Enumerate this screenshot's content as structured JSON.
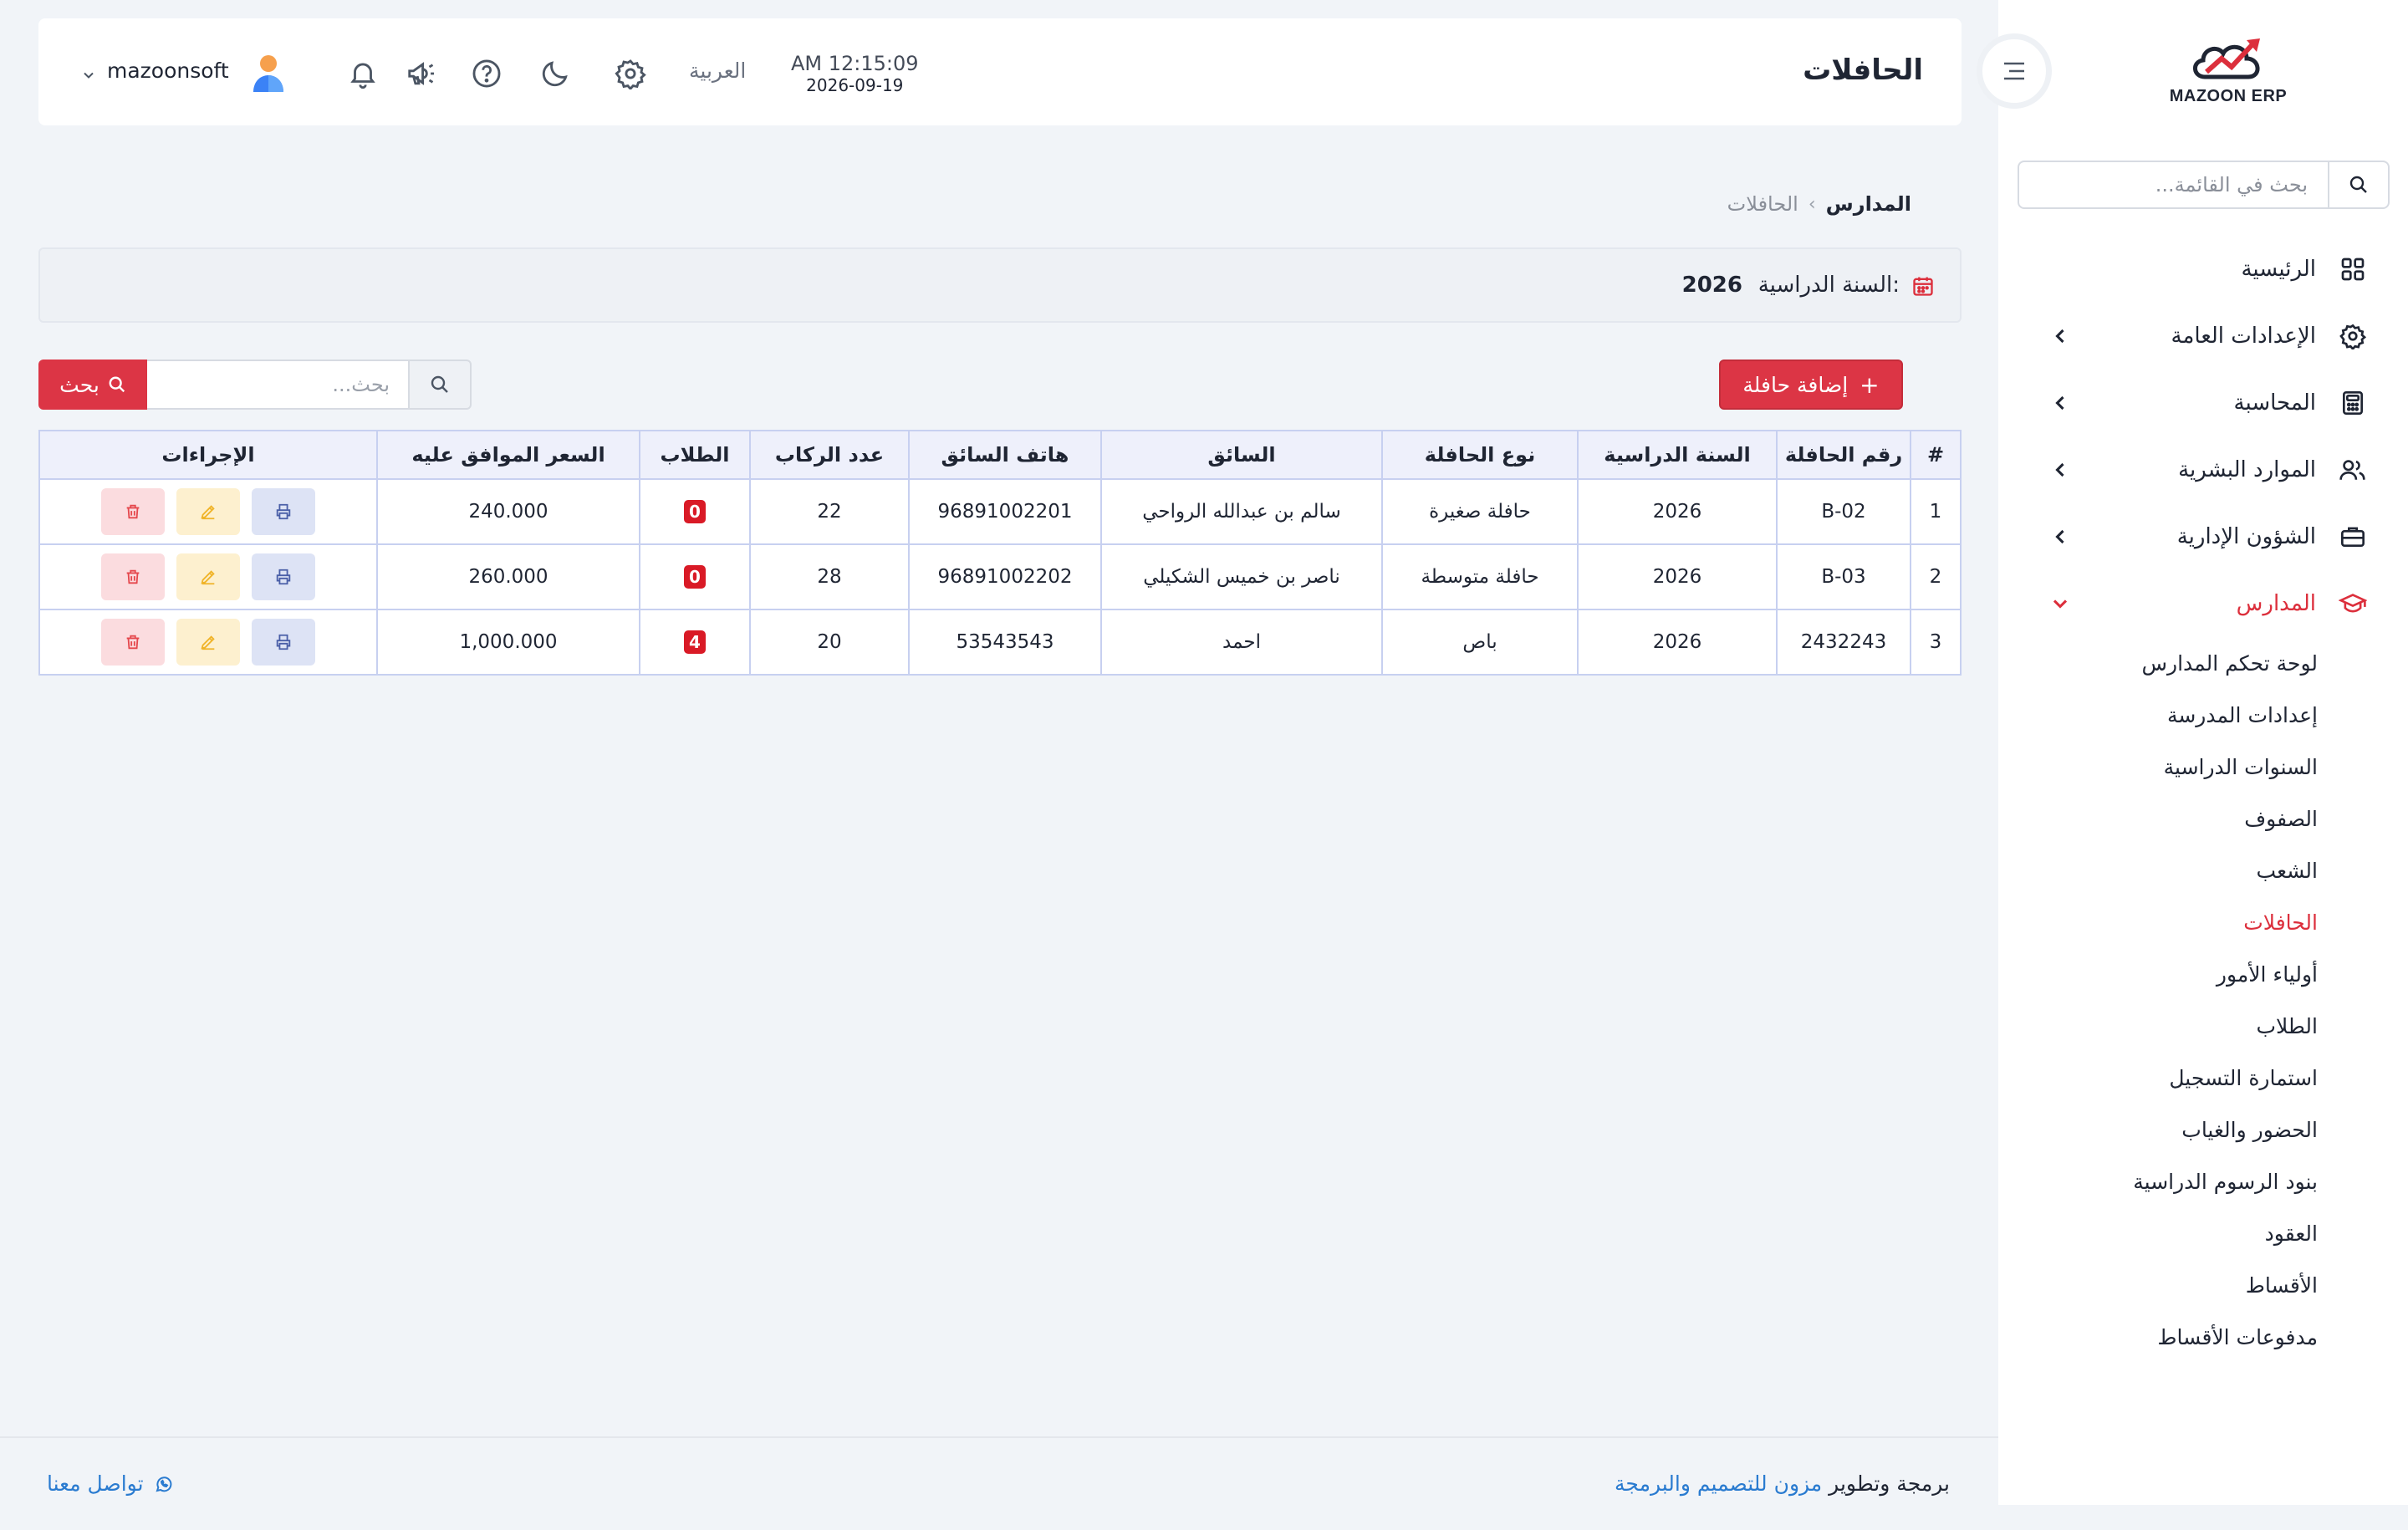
{
  "header": {
    "page_title": "الحافلات",
    "time": "AM 12:15:09",
    "date": "2026-09-19",
    "language": "العربية",
    "username": "mazoonsoft"
  },
  "sidebar": {
    "logo_text": "MAZOON ERP",
    "search_placeholder": "بحث في القائمة...",
    "items": [
      {
        "label": "الرئيسية",
        "icon": "grid-icon"
      },
      {
        "label": "الإعدادات العامة",
        "icon": "gear-icon"
      },
      {
        "label": "المحاسبة",
        "icon": "calculator-icon"
      },
      {
        "label": "الموارد البشرية",
        "icon": "users-icon"
      },
      {
        "label": "الشؤون الإدارية",
        "icon": "briefcase-icon"
      },
      {
        "label": "المدارس",
        "icon": "graduation-cap-icon"
      }
    ],
    "schools_submenu": [
      "لوحة تحكم المدارس",
      "إعدادات المدرسة",
      "السنوات الدراسية",
      "الصفوف",
      "الشعب",
      "الحافلات",
      "أولياء الأمور",
      "الطلاب",
      "استمارة التسجيل",
      "الحضور والغياب",
      "بنود الرسوم الدراسية",
      "العقود",
      "الأقساط",
      "مدفوعات الأقساط"
    ]
  },
  "breadcrumb": {
    "root": "المدارس",
    "separator": "‹",
    "current": "الحافلات"
  },
  "year_bar": {
    "label": "السنة الدراسية:",
    "value": "2026"
  },
  "toolbar": {
    "add_label": "إضافة حافلة",
    "add_icon": "+",
    "search_placeholder": "بحث...",
    "search_label": "بحث"
  },
  "table": {
    "columns": [
      "#",
      "رقم الحافلة",
      "السنة الدراسية",
      "نوع الحافلة",
      "السائق",
      "هاتف السائق",
      "عدد الركاب",
      "الطلاب",
      "السعر الموافق عليه",
      "الإجراءات"
    ],
    "rows": [
      {
        "num": "1",
        "bus_no": "B-02",
        "year": "2026",
        "type": "حافلة صغيرة",
        "driver": "سالم بن عبدالله الرواحي",
        "phone": "96891002201",
        "passengers": "22",
        "students": "0",
        "price": "240.000"
      },
      {
        "num": "2",
        "bus_no": "B-03",
        "year": "2026",
        "type": "حافلة متوسطة",
        "driver": "ناصر بن خميس الشكيلي",
        "phone": "96891002202",
        "passengers": "28",
        "students": "0",
        "price": "260.000"
      },
      {
        "num": "3",
        "bus_no": "2432243",
        "year": "2026",
        "type": "باص",
        "driver": "احمد",
        "phone": "53543543",
        "passengers": "20",
        "students": "4",
        "price": "1,000.000"
      }
    ]
  },
  "footer": {
    "credit_prefix": "برمجة وتطوير",
    "credit_link": "مزون للتصميم والبرمجة",
    "contact": "تواصل معنا"
  },
  "colors": {
    "accent": "#dc3545",
    "link": "#2a7bd0",
    "background": "#f1f4f8"
  }
}
